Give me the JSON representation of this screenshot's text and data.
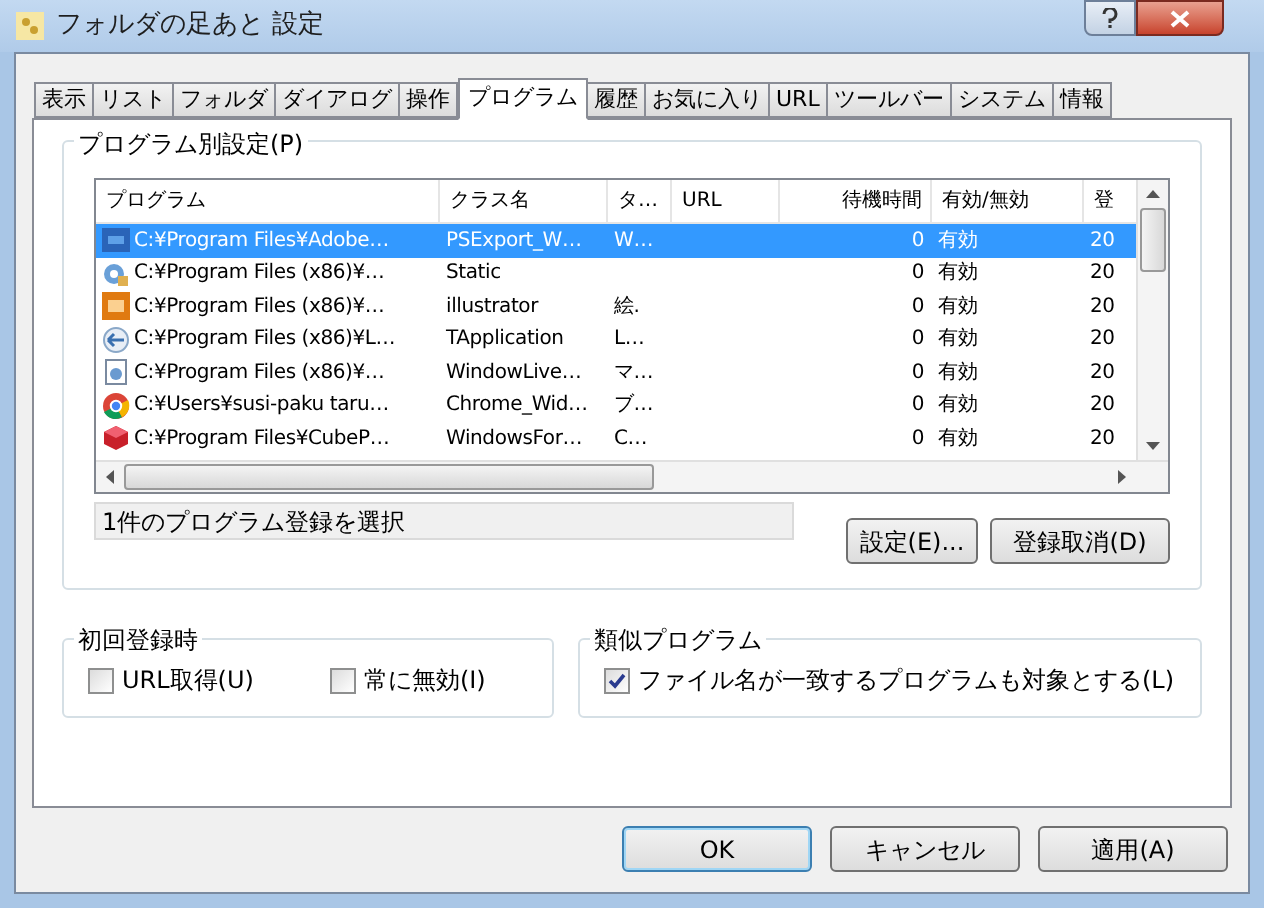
{
  "window": {
    "title": "フォルダの足あと 設定"
  },
  "tabs": [
    {
      "label": "表示",
      "selected": false
    },
    {
      "label": "リスト",
      "selected": false
    },
    {
      "label": "フォルダ",
      "selected": false
    },
    {
      "label": "ダイアログ",
      "selected": false
    },
    {
      "label": "操作",
      "selected": false
    },
    {
      "label": "プログラム",
      "selected": true
    },
    {
      "label": "履歴",
      "selected": false
    },
    {
      "label": "お気に入り",
      "selected": false
    },
    {
      "label": "URL",
      "selected": false
    },
    {
      "label": "ツールバー",
      "selected": false
    },
    {
      "label": "システム",
      "selected": false
    },
    {
      "label": "情報",
      "selected": false
    }
  ],
  "program_settings": {
    "title": "プログラム別設定(P)",
    "columns": [
      "プログラム",
      "クラス名",
      "タ…",
      "URL",
      "待機時間",
      "有効/無効",
      "登"
    ],
    "rows": [
      {
        "kind": "ps",
        "selected": true,
        "cells": [
          "C:¥Program Files¥Adobe…",
          "PSExport_W…",
          "W…",
          "",
          "0",
          "有効",
          "20"
        ]
      },
      {
        "kind": "gear",
        "selected": false,
        "cells": [
          "C:¥Program Files (x86)¥…",
          "Static",
          "",
          "",
          "0",
          "有効",
          "20"
        ]
      },
      {
        "kind": "ai",
        "selected": false,
        "cells": [
          "C:¥Program Files (x86)¥…",
          "illustrator",
          "絵.",
          "",
          "0",
          "有効",
          "20"
        ]
      },
      {
        "kind": "arrow",
        "selected": false,
        "cells": [
          "C:¥Program Files (x86)¥L…",
          "TApplication",
          "L…",
          "",
          "0",
          "有効",
          "20"
        ]
      },
      {
        "kind": "doc",
        "selected": false,
        "cells": [
          "C:¥Program Files (x86)¥…",
          "WindowLive…",
          "マ…",
          "",
          "0",
          "有効",
          "20"
        ]
      },
      {
        "kind": "chrome",
        "selected": false,
        "cells": [
          "C:¥Users¥susi-paku taru…",
          "Chrome_Wid…",
          "ブ…",
          "",
          "0",
          "有効",
          "20"
        ]
      },
      {
        "kind": "cube",
        "selected": false,
        "cells": [
          "C:¥Program Files¥CubeP…",
          "WindowsFor…",
          "C…",
          "",
          "0",
          "有効",
          "20"
        ]
      }
    ],
    "status": "1件のプログラム登録を選択",
    "buttons": [
      "設定(E)...",
      "登録取消(D)"
    ]
  },
  "first_registration": {
    "title": "初回登録時",
    "options": [
      {
        "label": "URL取得(U)",
        "checked": false
      },
      {
        "label": "常に無効(I)",
        "checked": false
      }
    ]
  },
  "similar_programs": {
    "title": "類似プログラム",
    "options": [
      {
        "label": "ファイル名が一致するプログラムも対象とする(L)",
        "checked": true
      }
    ]
  },
  "footer_buttons": [
    {
      "label": "OK",
      "default": true
    },
    {
      "label": "キャンセル",
      "default": false
    },
    {
      "label": "適用(A)",
      "default": false
    }
  ]
}
